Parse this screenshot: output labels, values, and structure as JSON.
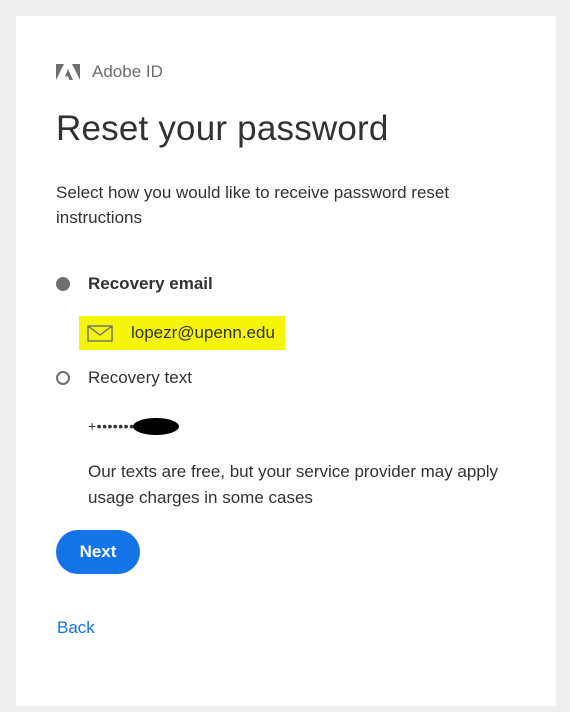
{
  "brand": {
    "name": "Adobe ID",
    "icon": "adobe-logo-icon"
  },
  "page": {
    "title": "Reset your password",
    "instructions": "Select how you would like to receive password reset instructions"
  },
  "options": {
    "email": {
      "label": "Recovery email",
      "selected": true,
      "value": "lopezr@upenn.edu",
      "icon": "mail-icon"
    },
    "text": {
      "label": "Recovery text",
      "selected": false,
      "phone_masked": "+•••••••",
      "notice": "Our texts are free, but your service provider may apply usage charges in some cases"
    }
  },
  "actions": {
    "next_label": "Next",
    "back_label": "Back"
  },
  "colors": {
    "accent": "#1473e6",
    "highlight": "#f5f50a",
    "text": "#323232",
    "muted": "#6e6e6e"
  }
}
